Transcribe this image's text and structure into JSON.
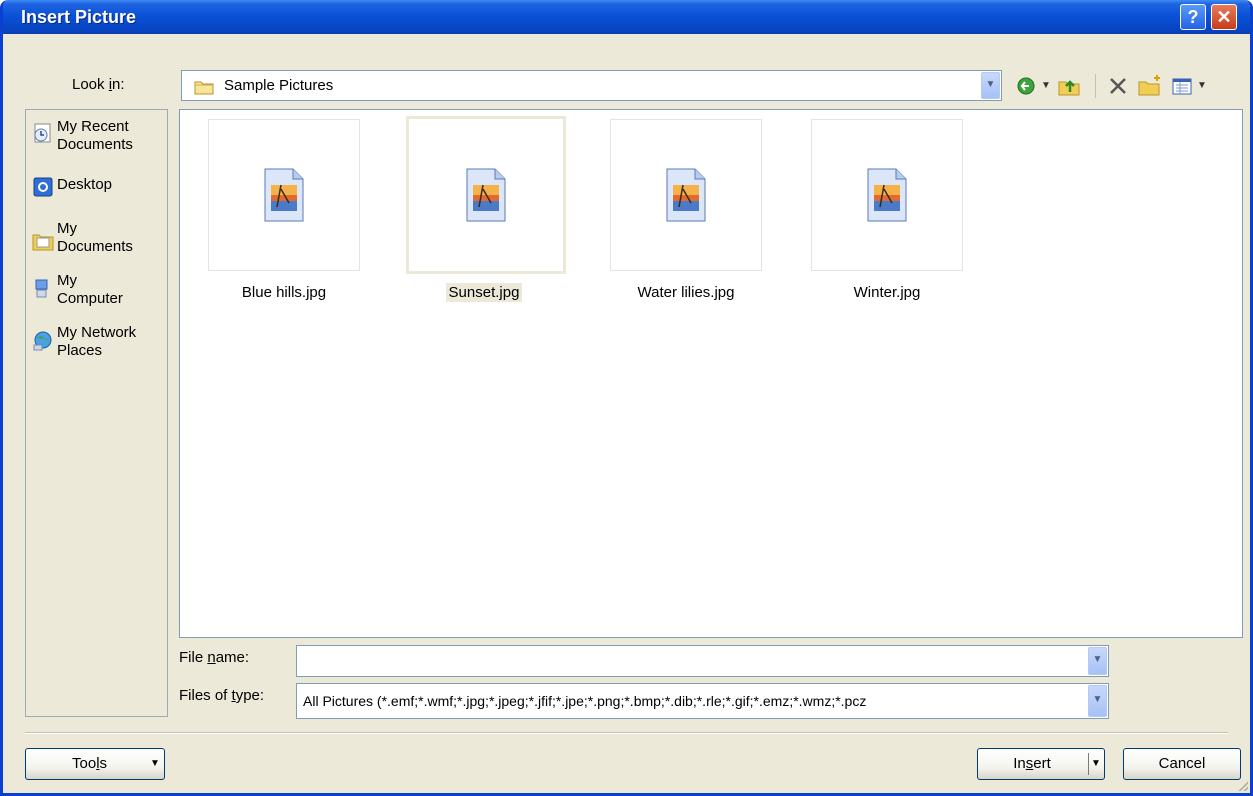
{
  "window": {
    "title": "Insert Picture",
    "help_glyph": "?",
    "close_glyph": "✕"
  },
  "look_in": {
    "label_pre": "Look ",
    "label_key": "i",
    "label_post": "n:",
    "value": "Sample Pictures"
  },
  "toolbar": {
    "back_icon": "back-icon",
    "up_icon": "up-one-level-icon",
    "delete_icon": "delete-icon",
    "new_folder_icon": "new-folder-icon",
    "views_icon": "views-icon"
  },
  "places": [
    {
      "label": "My Recent\nDocuments",
      "icon": "recent-documents-icon"
    },
    {
      "label": "Desktop",
      "icon": "desktop-icon"
    },
    {
      "label": "My\nDocuments",
      "icon": "my-documents-icon"
    },
    {
      "label": "My\nComputer",
      "icon": "my-computer-icon"
    },
    {
      "label": "My Network\nPlaces",
      "icon": "network-places-icon"
    }
  ],
  "files": [
    {
      "name": "Blue hills.jpg",
      "selected": false
    },
    {
      "name": "Sunset.jpg",
      "selected": true
    },
    {
      "name": "Water lilies.jpg",
      "selected": false
    },
    {
      "name": "Winter.jpg",
      "selected": false
    }
  ],
  "file_name": {
    "label_pre": "File ",
    "label_key": "n",
    "label_post": "ame:",
    "value": ""
  },
  "files_of_type": {
    "label_pre": "Files of ",
    "label_key": "t",
    "label_post": "ype:",
    "value": "All Pictures (*.emf;*.wmf;*.jpg;*.jpeg;*.jfif;*.jpe;*.png;*.bmp;*.dib;*.rle;*.gif;*.emz;*.wmz;*.pcz"
  },
  "buttons": {
    "tools_pre": "Too",
    "tools_key": "l",
    "tools_post": "s",
    "insert_pre": "In",
    "insert_key": "s",
    "insert_post": "ert",
    "cancel": "Cancel"
  },
  "colors": {
    "titlebar": "#0a52d8",
    "dialog_bg": "#ece9d8",
    "border": "#7f9db9"
  }
}
